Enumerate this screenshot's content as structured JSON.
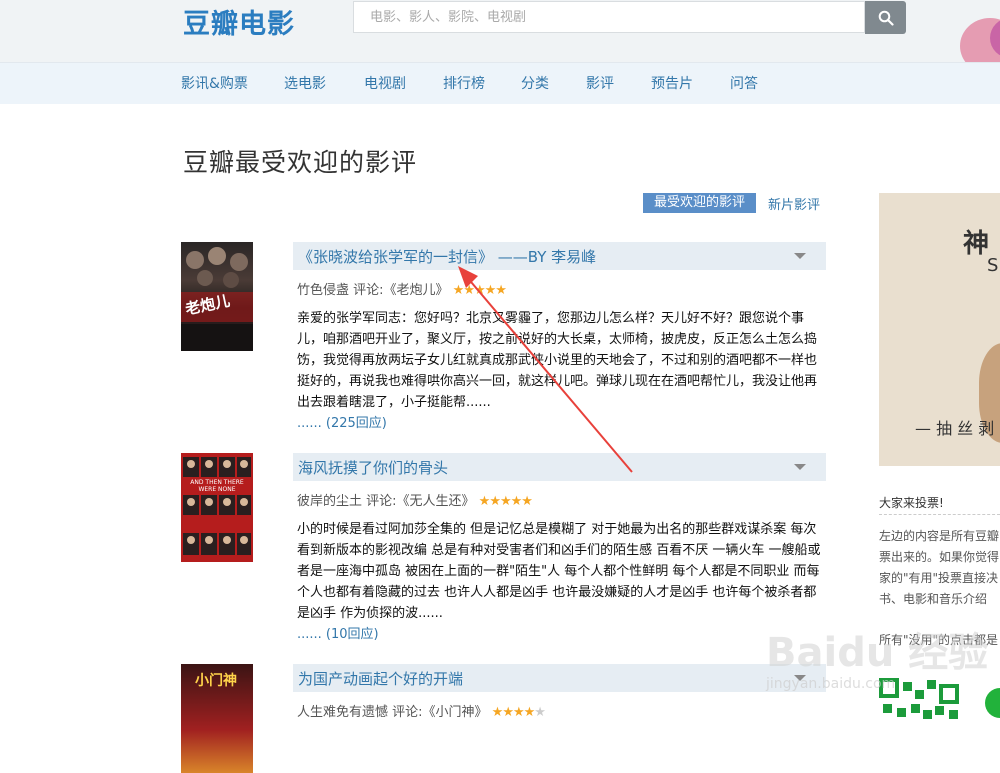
{
  "header": {
    "logo": "豆瓣电影",
    "search_placeholder": "电影、影人、影院、电视剧"
  },
  "nav": [
    "影讯&购票",
    "选电影",
    "电视剧",
    "排行榜",
    "分类",
    "影评",
    "预告片",
    "问答"
  ],
  "page_title": "豆瓣最受欢迎的影评",
  "tabs": {
    "active": "最受欢迎的影评",
    "other": "新片影评"
  },
  "reviews": [
    {
      "title": "《张晓波给张学军的一封信》 ——BY 李易峰",
      "author": "竹色侵盏",
      "meta_mid": " 评论:《老炮儿》",
      "stars": 5,
      "body": "亲爱的张学军同志：您好吗？北京又雾霾了，您那边儿怎么样？天儿好不好？跟您说个事儿，咱那酒吧开业了，聚义厅，按之前说好的大长桌，太师椅，披虎皮，反正怎么土怎么捣饬，我觉得再放两坛子女儿红就真成那武侠小说里的天地会了，不过和别的酒吧都不一样也挺好的，再说我也难得哄你高兴一回，就这样儿吧。弹球儿现在在酒吧帮忙儿，我没让他再出去跟着瞎混了，小子挺能帮......",
      "more": "...... (225回应)",
      "poster_text": "老炮儿"
    },
    {
      "title": "海风抚摸了你们的骨头",
      "author": "彼岸的尘土",
      "meta_mid": " 评论:《无人生还》",
      "stars": 5,
      "body": "小的时候是看过阿加莎全集的 但是记忆总是模糊了 对于她最为出名的那些群戏谋杀案 每次看到新版本的影视改编 总是有种对受害者们和凶手们的陌生感 百看不厌 一辆火车 一艘船或者是一座海中孤岛 被困在上面的一群\"陌生\"人 每个人都个性鲜明 每个人都是不同职业 而每个人也都有着隐藏的过去 也许人人都是凶手 也许最没嫌疑的人才是凶手 也许每个被杀者都是凶手 作为侦探的波......",
      "more": "...... (10回应)",
      "poster_text": "AND THEN THERE WERE NONE"
    },
    {
      "title": "为国产动画起个好的开端",
      "author": "人生难免有遗憾",
      "meta_mid": " 评论:《小门神》",
      "stars": 4,
      "poster_text": "小门神"
    }
  ],
  "sidebar": {
    "ad_title": "神",
    "ad_sub": "S",
    "ad_slogan": "— 抽 丝 剥",
    "vote_head": "大家来投票!",
    "p_lines": [
      "左边的内容是所有豆瓣",
      "票出来的。如果你觉得",
      "家的\"有用\"投票直接决",
      "书、电影和音乐介绍"
    ],
    "p2": "所有\"没用\"的点击都是"
  },
  "watermark": {
    "main": "Baidu 经验",
    "sub": "jingyan.baidu.com"
  },
  "colors": {
    "link": "#3377aa",
    "accent": "#5a8ec8",
    "star": "#f5a623",
    "arrow": "#e8413b"
  }
}
